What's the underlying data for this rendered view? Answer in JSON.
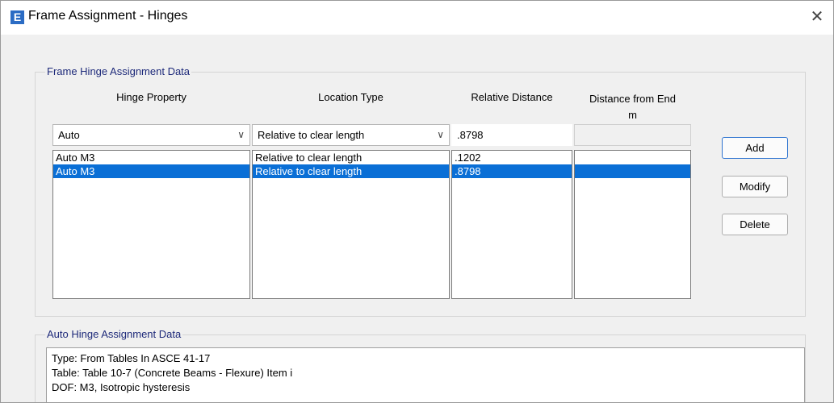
{
  "window": {
    "icon_letter": "E",
    "title": "Frame Assignment - Hinges",
    "close_symbol": "✕"
  },
  "hinge_data": {
    "group_title": "Frame Hinge Assignment Data",
    "columns": {
      "hinge_property": "Hinge Property",
      "location_type": "Location Type",
      "relative_distance": "Relative Distance",
      "distance_from_end": "Distance from End",
      "distance_units": "m"
    },
    "inputs": {
      "hinge_property": "Auto",
      "location_type": "Relative to clear length",
      "relative_distance": ".8798",
      "distance_from_end": ""
    },
    "rows": [
      {
        "hinge_property": "Auto  M3",
        "location_type": "Relative to clear length",
        "relative_distance": ".1202",
        "distance_from_end": "",
        "selected": false
      },
      {
        "hinge_property": "Auto  M3",
        "location_type": "Relative to clear length",
        "relative_distance": ".8798",
        "distance_from_end": "",
        "selected": true
      }
    ],
    "buttons": {
      "add": "Add",
      "modify": "Modify",
      "delete": "Delete"
    }
  },
  "auto_hinge": {
    "group_title": "Auto Hinge Assignment Data",
    "lines": [
      "Type:  From Tables In ASCE 41-17",
      "Table:  Table 10-7 (Concrete Beams - Flexure) Item i",
      "DOF:  M3, Isotropic hysteresis"
    ]
  },
  "colors": {
    "selection": "#0a6fd6",
    "group_title": "#1e2a7a",
    "app_icon": "#2b6cc4"
  }
}
